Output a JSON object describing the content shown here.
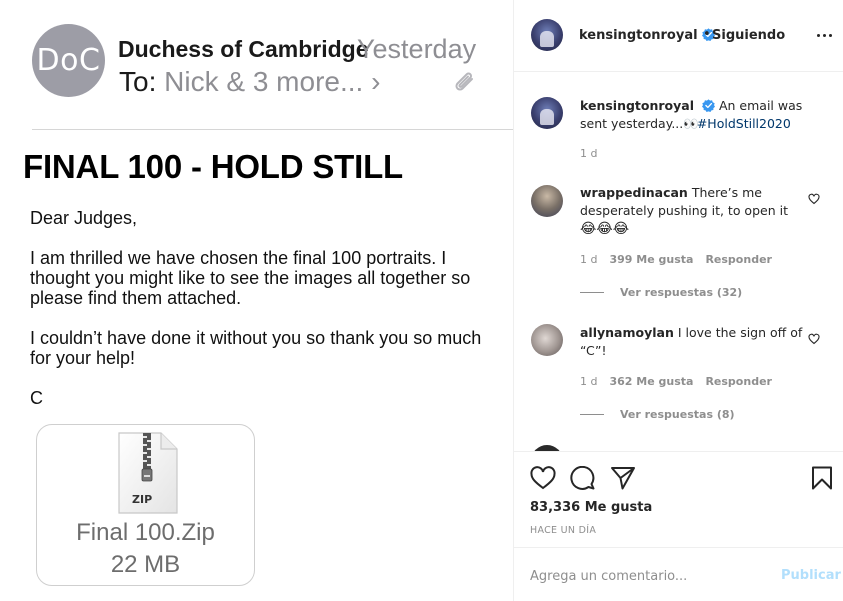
{
  "email": {
    "avatar_initials": "DoC",
    "sender": "Duchess of Cambridge",
    "time": "Yesterday",
    "to_label": "To:",
    "to_value": "Nick & 3 more...",
    "to_chevron": "›",
    "heading": "FINAL 100 - HOLD STILL",
    "greeting": "Dear Judges,",
    "paragraph1": "I am thrilled we have chosen the final 100 portraits. I thought you might like to see the images all together so please find them attached.",
    "paragraph2": "I couldn’t have done it without you so thank you so much for your help!",
    "signoff": "C",
    "attachment": {
      "badge": "ZIP",
      "name": "Final 100.Zip",
      "size": "22 MB"
    }
  },
  "post": {
    "header": {
      "username": "kensingtonroyal",
      "dot": "•",
      "follow_status": "Siguiendo"
    },
    "caption": {
      "username": "kensingtonroyal",
      "text": "An email was sent yesterday...",
      "emoji": "👀",
      "hashtag": "#HoldStill2020",
      "age": "1 d"
    },
    "comments": [
      {
        "username": "wrappedinacan",
        "text": "There’s me desperately pushing it, to open it",
        "emoji": "😂😂😂",
        "age": "1 d",
        "likes": "399 Me gusta",
        "reply": "Responder",
        "view_replies": "Ver respuestas (32)"
      },
      {
        "username": "allynamoylan",
        "text": "I love the sign off of “C”!",
        "age": "1 d",
        "likes": "362 Me gusta",
        "reply": "Responder",
        "view_replies": "Ver respuestas (8)"
      }
    ],
    "likes": "83,336 Me gusta",
    "posted": "HACE UN DÍA",
    "comment_placeholder": "Agrega un comentario...",
    "publish": "Publicar"
  },
  "colors": {
    "verified": "#3897f0",
    "hashtag": "#00376b",
    "publish_disabled": "#b2dffc",
    "muted": "#8e8e8e"
  },
  "icons": [
    "paperclip-icon",
    "zip-file-icon",
    "verified-badge-icon",
    "more-options-icon",
    "heart-icon",
    "comment-icon",
    "share-icon",
    "save-icon"
  ]
}
